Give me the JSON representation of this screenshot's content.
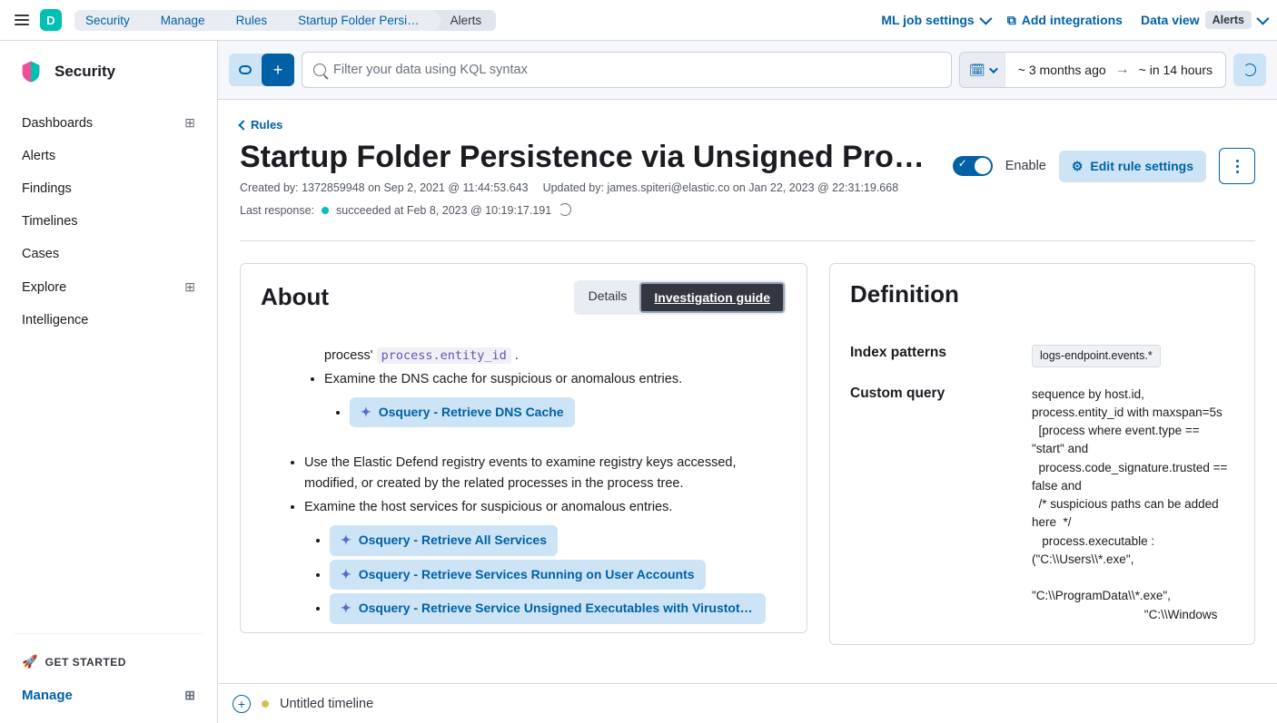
{
  "header": {
    "logo_letter": "D",
    "breadcrumbs": [
      "Security",
      "Manage",
      "Rules",
      "Startup Folder Persi…",
      "Alerts"
    ],
    "ml_link": "ML job settings",
    "add_integrations": "Add integrations",
    "data_view": "Data view",
    "data_view_badge": "Alerts"
  },
  "sidebar": {
    "title": "Security",
    "items": [
      "Dashboards",
      "Alerts",
      "Findings",
      "Timelines",
      "Cases",
      "Explore",
      "Intelligence"
    ],
    "get_started": "GET STARTED",
    "manage": "Manage"
  },
  "query": {
    "placeholder": "Filter your data using KQL syntax",
    "range_from": "~ 3 months ago",
    "range_to": "~ in 14 hours"
  },
  "page": {
    "back": "Rules",
    "title": "Startup Folder Persistence via Unsigned Pro…",
    "created_by": "Created by: 1372859948 on Sep 2, 2021 @ 11:44:53.643",
    "updated_by": "Updated by: james.spiteri@elastic.co on Jan 22, 2023 @ 22:31:19.668",
    "last_response_label": "Last response:",
    "last_response_value": "succeeded at Feb 8, 2023 @ 10:19:17.191",
    "enable_label": "Enable",
    "edit_btn": "Edit rule settings"
  },
  "about": {
    "title": "About",
    "tabs": {
      "details": "Details",
      "guide": "Investigation guide"
    },
    "text1_prefix": "process' ",
    "code1": "process.entity_id",
    "text1_suffix": " .",
    "item_dns": "Examine the DNS cache for suspicious or anomalous entries.",
    "osq_dns": "Osquery - Retrieve DNS Cache",
    "item_registry": "Use the Elastic Defend registry events to examine registry keys accessed, modified, or created by the related processes in the process tree.",
    "item_services": "Examine the host services for suspicious or anomalous entries.",
    "osq_all": "Osquery - Retrieve All Services",
    "osq_user": "Osquery - Retrieve Services Running on User Accounts",
    "osq_vt": "Osquery - Retrieve Service Unsigned Executables with Virustotal …"
  },
  "definition": {
    "title": "Definition",
    "index_label": "Index patterns",
    "index_val": "logs-endpoint.events.*",
    "query_label": "Custom query",
    "query_val": "sequence by host.id, process.entity_id with maxspan=5s\n  [process where event.type == \"start\" and\n  process.code_signature.trusted == false and\n  /* suspicious paths can be added here  */\n   process.executable : (\"C:\\\\Users\\\\*.exe\",\n\n\"C:\\\\ProgramData\\\\*.exe\",\n                                 \"C:\\\\Windows"
  },
  "timeline": {
    "title": "Untitled timeline"
  }
}
